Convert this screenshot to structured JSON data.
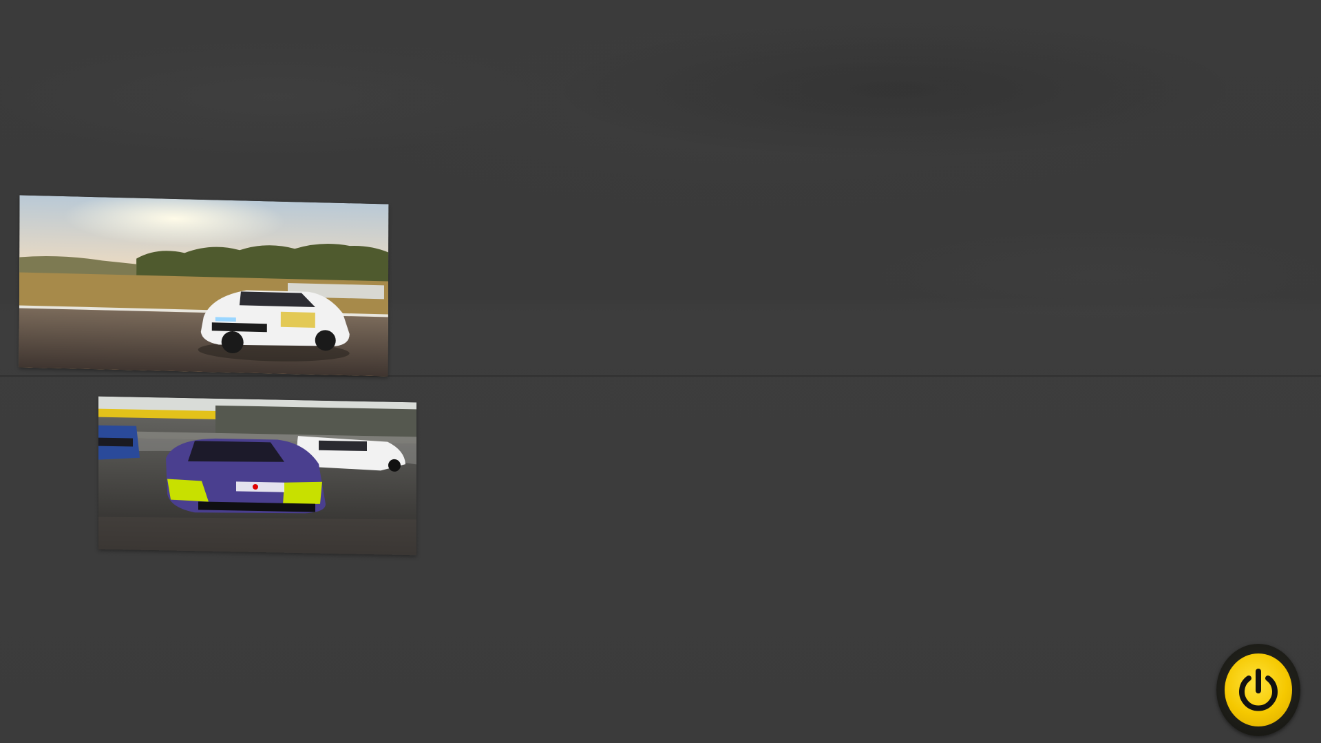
{
  "screen": {
    "background_color": "#3a3a3a"
  },
  "tiles": [
    {
      "scene": "white-gt4-race-car-sunset-track",
      "sky_color": "#e9d8c0",
      "car_color": "#f2f2f2"
    },
    {
      "scene": "purple-gt3-race-car-pack-wet-track",
      "car_color": "#4a3f8f",
      "accent_color": "#c8e000"
    }
  ],
  "power_button": {
    "icon": "power-icon",
    "color": "#f5c800",
    "ring_color": "#1d1d18"
  }
}
